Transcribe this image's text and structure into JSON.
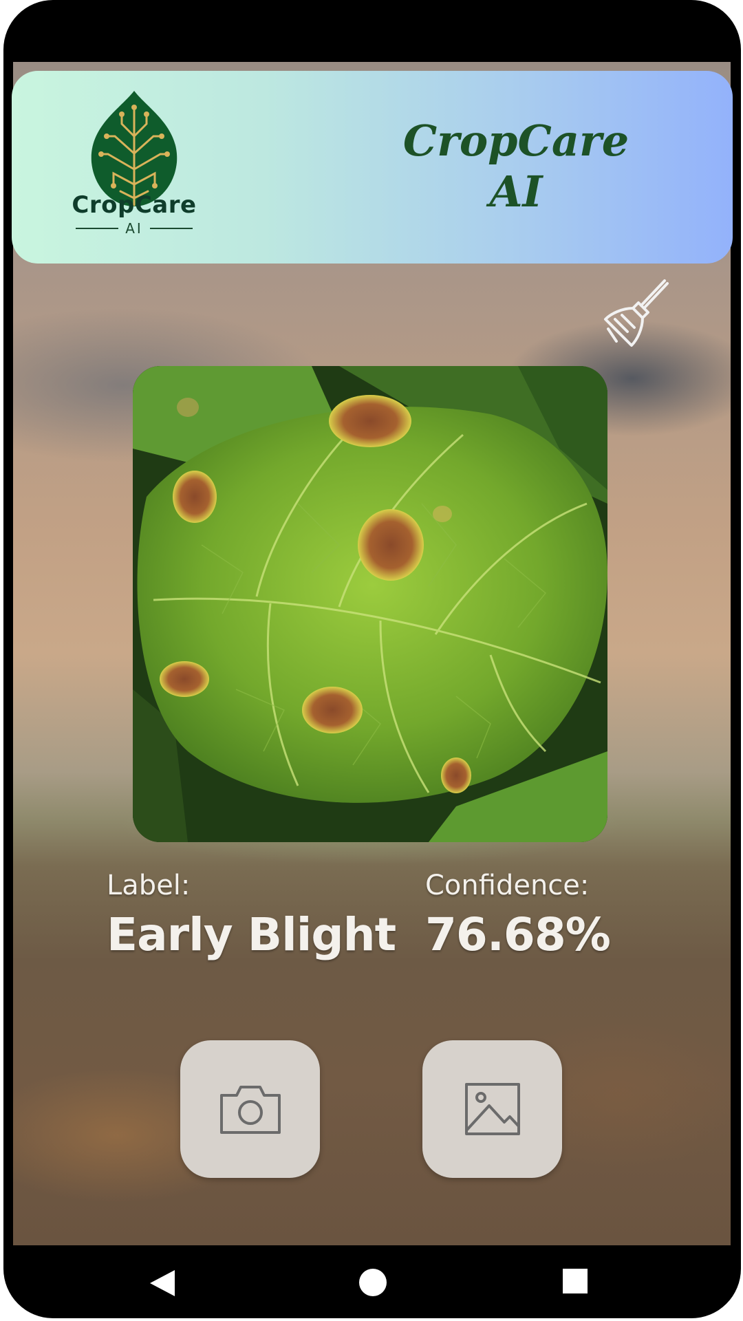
{
  "app": {
    "logo_text": "CropCare",
    "logo_subtext": "AI",
    "title_line1": "CropCare",
    "title_line2": "AI"
  },
  "result": {
    "label_caption": "Label:",
    "label_value": "Early Blight",
    "confidence_caption": "Confidence:",
    "confidence_value": "76.68%"
  },
  "icons": {
    "clear": "broom-icon",
    "camera": "camera-icon",
    "gallery": "image-icon",
    "nav_back": "back-triangle-icon",
    "nav_home": "home-circle-icon",
    "nav_recent": "recent-square-icon"
  },
  "colors": {
    "header_gradient_start": "#c9f5df",
    "header_gradient_end": "#93b2fb",
    "title_green": "#1d5227",
    "logo_dark_green": "#0f3d2b",
    "button_bg": "#d7d2cc"
  }
}
